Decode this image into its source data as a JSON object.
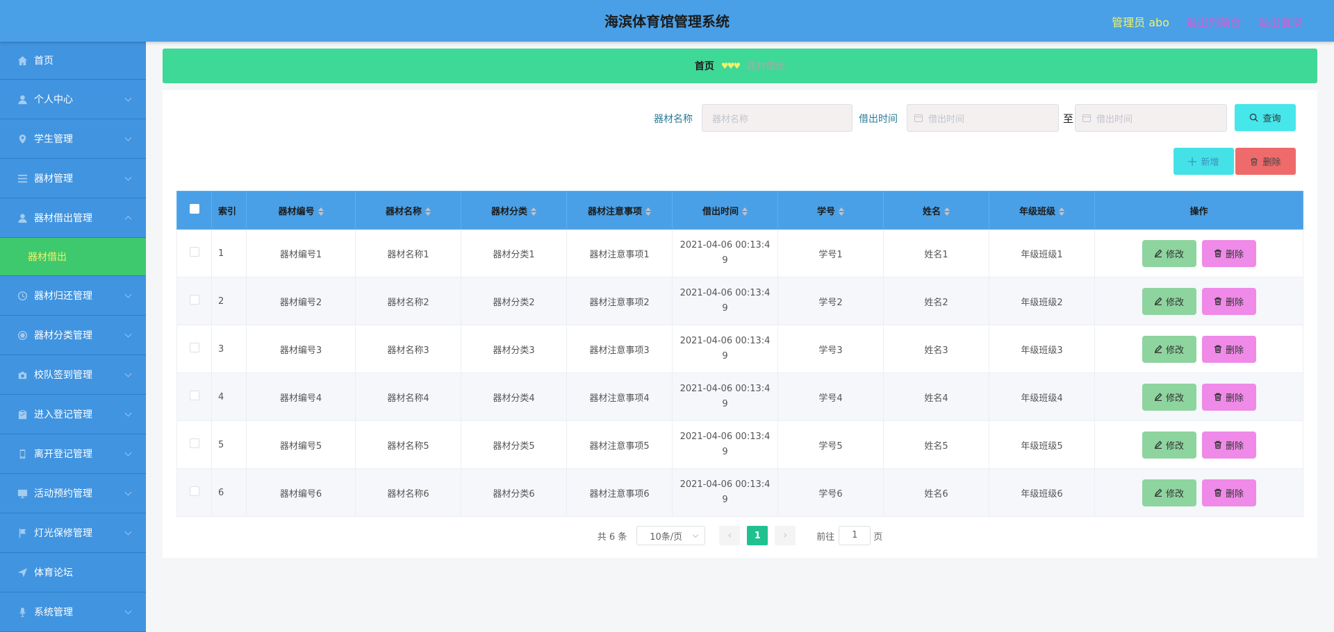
{
  "header": {
    "title": "海滨体育馆管理系统",
    "admin": "管理员 abo",
    "to_front": "退出到前台",
    "logout": "退出登录"
  },
  "sidebar": {
    "items": [
      {
        "label": "首页",
        "icon": "home-icon"
      },
      {
        "label": "个人中心",
        "icon": "user-icon"
      },
      {
        "label": "学生管理",
        "icon": "location-icon"
      },
      {
        "label": "器材管理",
        "icon": "list-icon"
      },
      {
        "label": "器材借出管理",
        "icon": "user-icon",
        "expanded": true
      },
      {
        "label": "器材归还管理",
        "icon": "clock-icon"
      },
      {
        "label": "器材分类管理",
        "icon": "circle-icon"
      },
      {
        "label": "校队签到管理",
        "icon": "camera-icon"
      },
      {
        "label": "进入登记管理",
        "icon": "clipboard-icon"
      },
      {
        "label": "离开登记管理",
        "icon": "phone-icon"
      },
      {
        "label": "活动预约管理",
        "icon": "monitor-icon"
      },
      {
        "label": "灯光保修管理",
        "icon": "flag-icon"
      },
      {
        "label": "体育论坛",
        "icon": "send-icon"
      },
      {
        "label": "系统管理",
        "icon": "mic-icon"
      }
    ],
    "sub_item": "器材借出"
  },
  "breadcrumb": {
    "home": "首页",
    "separator": "♥♥♥",
    "current": "器材借出"
  },
  "search": {
    "name_label": "器材名称",
    "name_placeholder": "器材名称",
    "time_label": "借出时间",
    "start_placeholder": "借出时间",
    "to": "至",
    "end_placeholder": "借出时间",
    "query": "查询"
  },
  "actions": {
    "add": "新增",
    "delete": "删除"
  },
  "table": {
    "columns": [
      "索引",
      "器材编号",
      "器材名称",
      "器材分类",
      "器材注意事项",
      "借出时间",
      "学号",
      "姓名",
      "年级班级",
      "操作"
    ],
    "rows": [
      {
        "idx": "1",
        "code": "器材编号1",
        "name": "器材名称1",
        "cat": "器材分类1",
        "note": "器材注意事项1",
        "time": "2021-04-06 00:13:49",
        "sid": "学号1",
        "sname": "姓名1",
        "cls": "年级班级1"
      },
      {
        "idx": "2",
        "code": "器材编号2",
        "name": "器材名称2",
        "cat": "器材分类2",
        "note": "器材注意事项2",
        "time": "2021-04-06 00:13:49",
        "sid": "学号2",
        "sname": "姓名2",
        "cls": "年级班级2"
      },
      {
        "idx": "3",
        "code": "器材编号3",
        "name": "器材名称3",
        "cat": "器材分类3",
        "note": "器材注意事项3",
        "time": "2021-04-06 00:13:49",
        "sid": "学号3",
        "sname": "姓名3",
        "cls": "年级班级3"
      },
      {
        "idx": "4",
        "code": "器材编号4",
        "name": "器材名称4",
        "cat": "器材分类4",
        "note": "器材注意事项4",
        "time": "2021-04-06 00:13:49",
        "sid": "学号4",
        "sname": "姓名4",
        "cls": "年级班级4"
      },
      {
        "idx": "5",
        "code": "器材编号5",
        "name": "器材名称5",
        "cat": "器材分类5",
        "note": "器材注意事项5",
        "time": "2021-04-06 00:13:49",
        "sid": "学号5",
        "sname": "姓名5",
        "cls": "年级班级5"
      },
      {
        "idx": "6",
        "code": "器材编号6",
        "name": "器材名称6",
        "cat": "器材分类6",
        "note": "器材注意事项6",
        "time": "2021-04-06 00:13:49",
        "sid": "学号6",
        "sname": "姓名6",
        "cls": "年级班级6"
      }
    ],
    "edit_label": "修改",
    "delete_label": "删除"
  },
  "pagination": {
    "total": "共 6 条",
    "page_size": "10条/页",
    "prev": "‹",
    "current_page": "1",
    "next": "›",
    "goto_label": "前往",
    "goto_value": "1",
    "page_unit": "页"
  },
  "colors": {
    "header_bg": "#4aa0e6",
    "sidebar_bg": "#4194e0",
    "active_sub_bg": "#3ec96e",
    "breadcrumb_bg": "#3ed897",
    "accent_yellow": "#f0f36a",
    "link_magenta": "#d35bd3"
  }
}
